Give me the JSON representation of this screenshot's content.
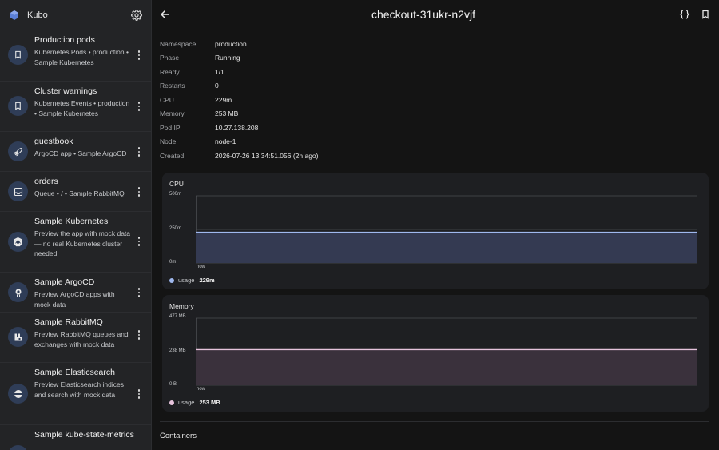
{
  "sidebar": {
    "app_name": "Kubo",
    "items": [
      {
        "name": "Production pods",
        "sub": "Kubernetes Pods • production • Sample Kubernetes",
        "icon": "bookmark-icon"
      },
      {
        "name": "Cluster warnings",
        "sub": "Kubernetes Events • production • Sample Kubernetes",
        "icon": "bookmark-icon"
      },
      {
        "name": "guestbook",
        "sub": "ArgoCD app • Sample ArgoCD",
        "icon": "rocket-icon"
      },
      {
        "name": "orders",
        "sub": "Queue • / • Sample RabbitMQ",
        "icon": "inbox-icon"
      },
      {
        "name": "Sample Kubernetes",
        "sub": "Preview the app with mock data — no real Kubernetes cluster needed",
        "icon": "kubernetes-icon"
      },
      {
        "name": "Sample ArgoCD",
        "sub": "Preview ArgoCD apps with mock data",
        "icon": "argocd-icon"
      },
      {
        "name": "Sample RabbitMQ",
        "sub": "Preview RabbitMQ queues and exchanges with mock data",
        "icon": "rabbitmq-icon"
      },
      {
        "name": "Sample Elasticsearch",
        "sub": "Preview Elasticsearch indices and search with mock data",
        "icon": "elasticsearch-icon"
      },
      {
        "name": "Sample kube-state-metrics",
        "sub": "",
        "icon": "metrics-icon"
      }
    ]
  },
  "header": {
    "title": "checkout-31ukr-n2vjf"
  },
  "properties": [
    {
      "key": "Namespace",
      "value": "production"
    },
    {
      "key": "Phase",
      "value": "Running"
    },
    {
      "key": "Ready",
      "value": "1/1"
    },
    {
      "key": "Restarts",
      "value": "0"
    },
    {
      "key": "CPU",
      "value": "229m"
    },
    {
      "key": "Memory",
      "value": "253 MB"
    },
    {
      "key": "Pod IP",
      "value": "10.27.138.208"
    },
    {
      "key": "Node",
      "value": "node-1"
    },
    {
      "key": "Created",
      "value": "2026-07-26 13:34:51.056 (2h ago)"
    }
  ],
  "cpu_card": {
    "title": "CPU",
    "y_ticks": [
      "500m",
      "250m",
      "0m"
    ],
    "x_label": "now",
    "legend_name": "usage",
    "legend_value": "229m",
    "color": "#9fb8ee"
  },
  "memory_card": {
    "title": "Memory",
    "y_ticks": [
      "477 MB",
      "238 MB",
      "0 B"
    ],
    "x_label": "now",
    "legend_name": "usage",
    "legend_value": "253 MB",
    "color": "#e6c3dc"
  },
  "containers_label": "Containers",
  "chart_data": [
    {
      "type": "area",
      "title": "CPU",
      "ylim": [
        0,
        500
      ],
      "y_unit": "m",
      "series": [
        {
          "name": "usage",
          "values": [
            229,
            229
          ]
        }
      ],
      "x": [
        "",
        "now"
      ]
    },
    {
      "type": "area",
      "title": "Memory",
      "ylim": [
        0,
        477
      ],
      "y_unit": "MB",
      "series": [
        {
          "name": "usage",
          "values": [
            253,
            253
          ]
        }
      ],
      "x": [
        "",
        "now"
      ]
    }
  ]
}
